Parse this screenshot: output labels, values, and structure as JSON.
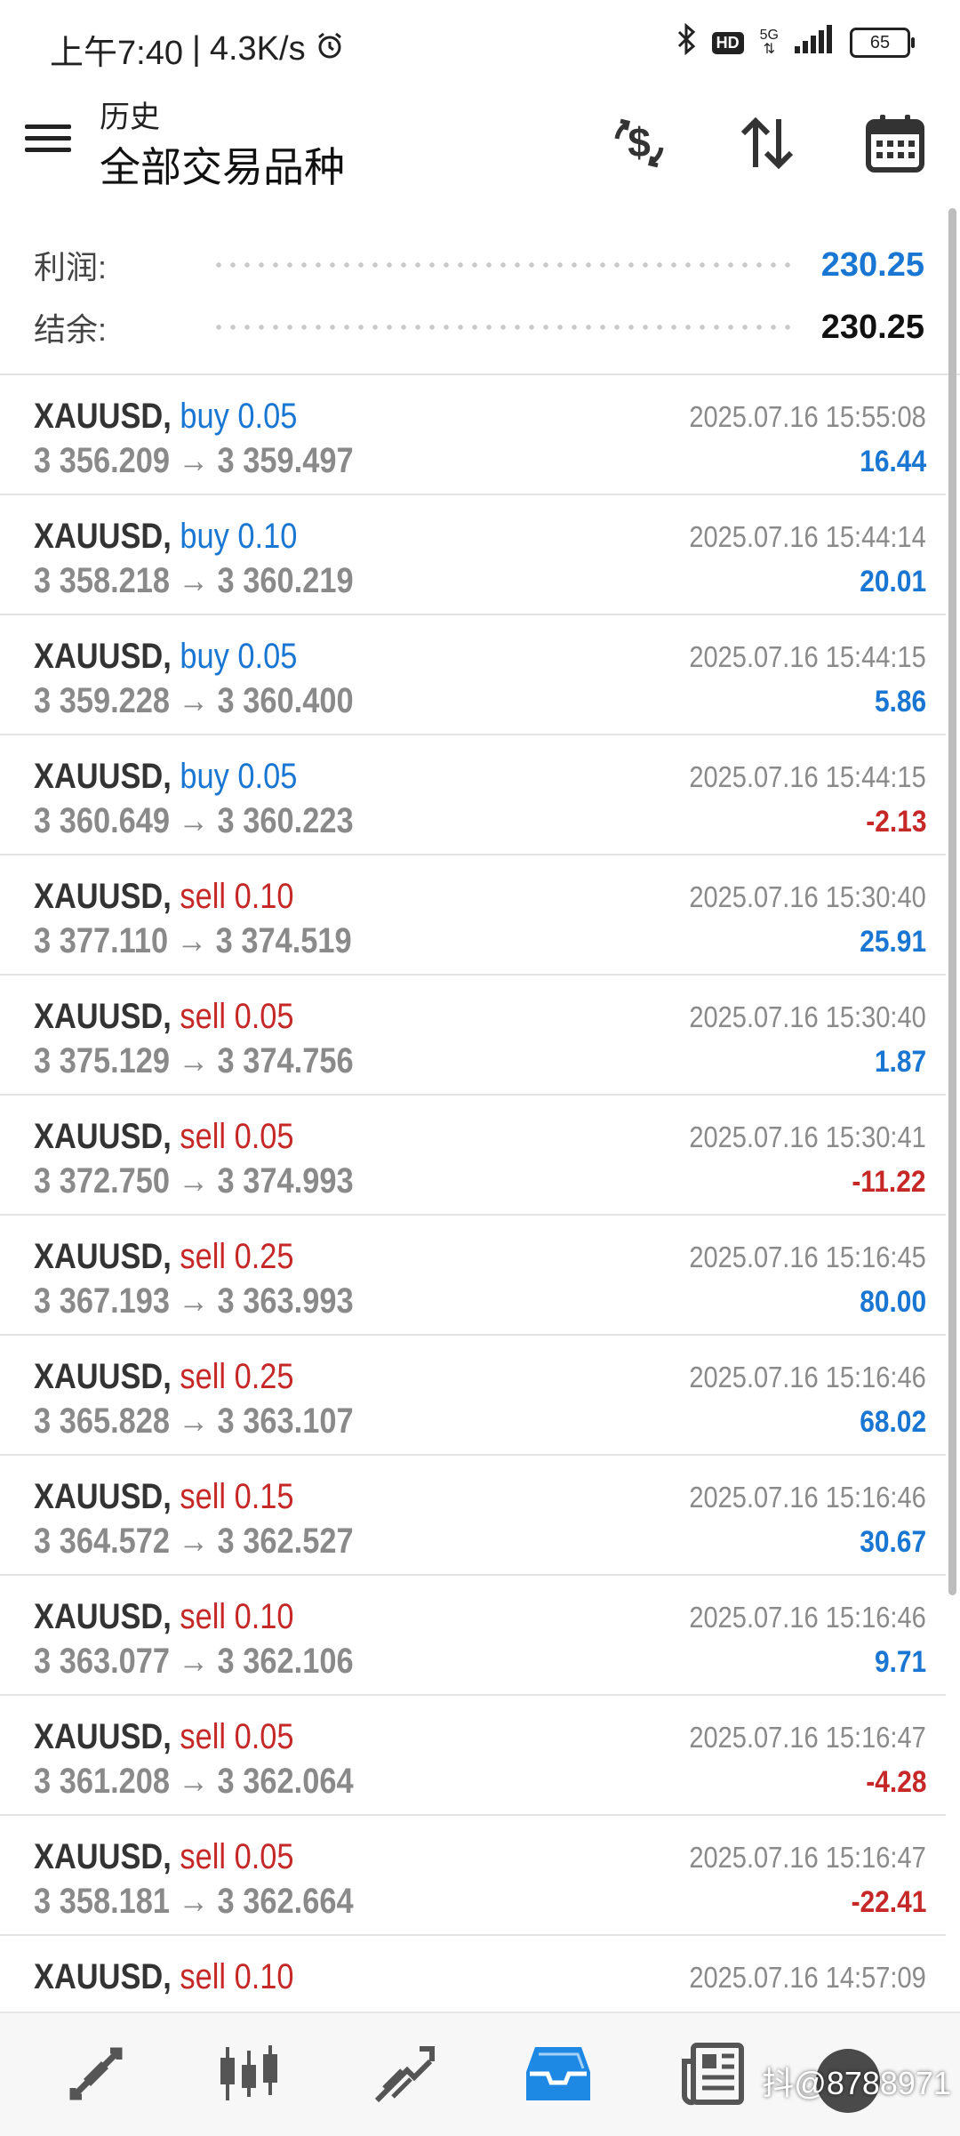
{
  "colors": {
    "buy": "#1976d2",
    "sell": "#c62828",
    "profit_pos": "#1976d2",
    "profit_neg": "#c62828",
    "active_tab": "#1e88e5"
  },
  "status_bar": {
    "time": "上午7:40",
    "speed": "4.3K/s",
    "hd": "HD",
    "network": "5G",
    "battery": "65"
  },
  "header": {
    "subtitle": "历史",
    "title": "全部交易品种"
  },
  "summary": {
    "profit_label": "利润:",
    "profit_value": "230.25",
    "balance_label": "结余:",
    "balance_value": "230.25"
  },
  "deals": [
    {
      "symbol": "XAUUSD,",
      "type": "buy 0.05",
      "side": "buy",
      "prices": "3 356.209 → 3 359.497",
      "time": "2025.07.16 15:55:08",
      "profit": "16.44"
    },
    {
      "symbol": "XAUUSD,",
      "type": "buy 0.10",
      "side": "buy",
      "prices": "3 358.218 → 3 360.219",
      "time": "2025.07.16 15:44:14",
      "profit": "20.01"
    },
    {
      "symbol": "XAUUSD,",
      "type": "buy 0.05",
      "side": "buy",
      "prices": "3 359.228 → 3 360.400",
      "time": "2025.07.16 15:44:15",
      "profit": "5.86"
    },
    {
      "symbol": "XAUUSD,",
      "type": "buy 0.05",
      "side": "buy",
      "prices": "3 360.649 → 3 360.223",
      "time": "2025.07.16 15:44:15",
      "profit": "-2.13"
    },
    {
      "symbol": "XAUUSD,",
      "type": "sell 0.10",
      "side": "sell",
      "prices": "3 377.110 → 3 374.519",
      "time": "2025.07.16 15:30:40",
      "profit": "25.91"
    },
    {
      "symbol": "XAUUSD,",
      "type": "sell 0.05",
      "side": "sell",
      "prices": "3 375.129 → 3 374.756",
      "time": "2025.07.16 15:30:40",
      "profit": "1.87"
    },
    {
      "symbol": "XAUUSD,",
      "type": "sell 0.05",
      "side": "sell",
      "prices": "3 372.750 → 3 374.993",
      "time": "2025.07.16 15:30:41",
      "profit": "-11.22"
    },
    {
      "symbol": "XAUUSD,",
      "type": "sell 0.25",
      "side": "sell",
      "prices": "3 367.193 → 3 363.993",
      "time": "2025.07.16 15:16:45",
      "profit": "80.00"
    },
    {
      "symbol": "XAUUSD,",
      "type": "sell 0.25",
      "side": "sell",
      "prices": "3 365.828 → 3 363.107",
      "time": "2025.07.16 15:16:46",
      "profit": "68.02"
    },
    {
      "symbol": "XAUUSD,",
      "type": "sell 0.15",
      "side": "sell",
      "prices": "3 364.572 → 3 362.527",
      "time": "2025.07.16 15:16:46",
      "profit": "30.67"
    },
    {
      "symbol": "XAUUSD,",
      "type": "sell 0.10",
      "side": "sell",
      "prices": "3 363.077 → 3 362.106",
      "time": "2025.07.16 15:16:46",
      "profit": "9.71"
    },
    {
      "symbol": "XAUUSD,",
      "type": "sell 0.05",
      "side": "sell",
      "prices": "3 361.208 → 3 362.064",
      "time": "2025.07.16 15:16:47",
      "profit": "-4.28"
    },
    {
      "symbol": "XAUUSD,",
      "type": "sell 0.05",
      "side": "sell",
      "prices": "3 358.181 → 3 362.664",
      "time": "2025.07.16 15:16:47",
      "profit": "-22.41"
    },
    {
      "symbol": "XAUUSD,",
      "type": "sell 0.10",
      "side": "sell",
      "prices": "",
      "time": "2025.07.16 14:57:09",
      "profit": ""
    }
  ],
  "bottom_nav": [
    {
      "icon": "quotes-icon",
      "active": false
    },
    {
      "icon": "chart-icon",
      "active": false
    },
    {
      "icon": "trade-icon",
      "active": false
    },
    {
      "icon": "history-icon",
      "active": true
    },
    {
      "icon": "news-icon",
      "active": false
    }
  ],
  "watermark": "抖@8788971"
}
